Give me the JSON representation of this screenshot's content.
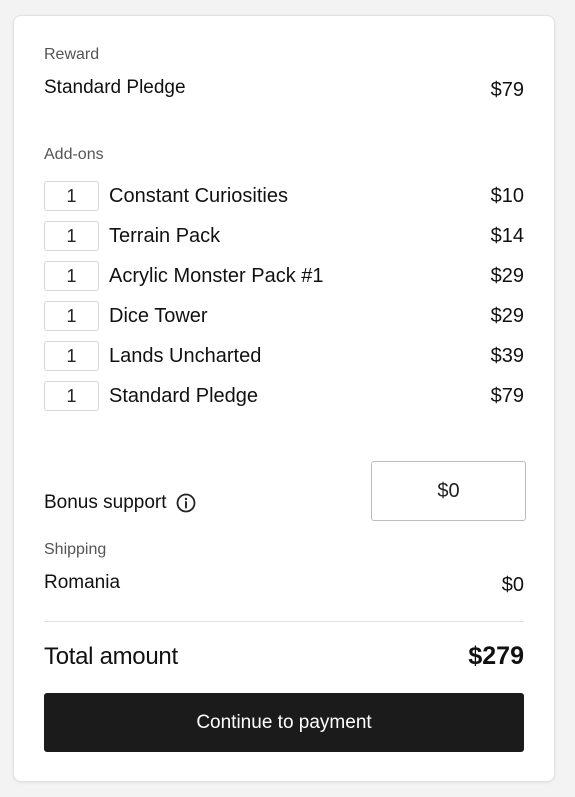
{
  "reward": {
    "label": "Reward",
    "name": "Standard Pledge",
    "price": "$79"
  },
  "addons": {
    "label": "Add-ons",
    "items": [
      {
        "qty": "1",
        "name": "Constant Curiosities",
        "price": "$10"
      },
      {
        "qty": "1",
        "name": "Terrain Pack",
        "price": "$14"
      },
      {
        "qty": "1",
        "name": "Acrylic Monster Pack #1",
        "price": "$29"
      },
      {
        "qty": "1",
        "name": "Dice Tower",
        "price": "$29"
      },
      {
        "qty": "1",
        "name": "Lands Uncharted",
        "price": "$39"
      },
      {
        "qty": "1",
        "name": "Standard Pledge",
        "price": "$79"
      }
    ]
  },
  "bonus": {
    "label": "Bonus support",
    "icon": "info-icon",
    "value": "$0"
  },
  "shipping": {
    "label": "Shipping",
    "country": "Romania",
    "price": "$0"
  },
  "total": {
    "label": "Total amount",
    "value": "$279"
  },
  "cta": {
    "label": "Continue to payment"
  },
  "colors": {
    "button_bg": "#1b1b1b",
    "button_text": "#ffffff",
    "page_bg": "#f3f3f3"
  }
}
